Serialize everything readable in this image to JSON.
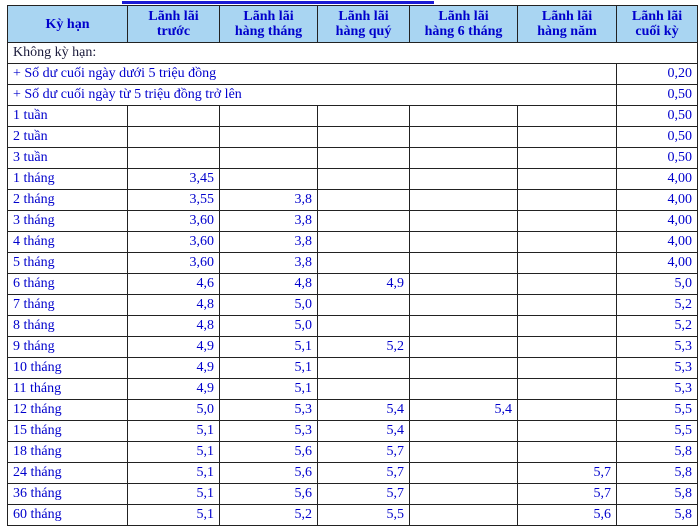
{
  "columns": [
    "Kỳ hạn",
    "Lãnh lãi trước",
    "Lãnh lãi hàng tháng",
    "Lãnh lãi hàng quý",
    "Lãnh lãi hàng 6 tháng",
    "Lãnh lãi hàng năm",
    "Lãnh lãi cuối kỳ"
  ],
  "header_lines": [
    [
      "Kỳ hạn",
      ""
    ],
    [
      "Lãnh lãi",
      "trước"
    ],
    [
      "Lãnh lãi",
      "hàng tháng"
    ],
    [
      "Lãnh lãi",
      "hàng quý"
    ],
    [
      "Lãnh lãi",
      "hàng 6 tháng"
    ],
    [
      "Lãnh lãi",
      "hàng năm"
    ],
    [
      "Lãnh lãi",
      "cuối kỳ"
    ]
  ],
  "group_label": "Không kỳ hạn:",
  "demand_rows": [
    {
      "label": "+ Số dư cuối ngày dưới 5 triệu đồng",
      "rate": "0,20"
    },
    {
      "label": "+ Số dư cuối ngày từ 5 triệu đồng trở lên",
      "rate": "0,50"
    }
  ],
  "rows": [
    {
      "term": "1 tuần",
      "values": [
        "",
        "",
        "",
        "",
        "",
        "0,50"
      ]
    },
    {
      "term": "2 tuần",
      "values": [
        "",
        "",
        "",
        "",
        "",
        "0,50"
      ]
    },
    {
      "term": "3 tuần",
      "values": [
        "",
        "",
        "",
        "",
        "",
        "0,50"
      ]
    },
    {
      "term": "1 tháng",
      "values": [
        "3,45",
        "",
        "",
        "",
        "",
        "4,00"
      ]
    },
    {
      "term": "2 tháng",
      "values": [
        "3,55",
        "3,8",
        "",
        "",
        "",
        "4,00"
      ]
    },
    {
      "term": "3 tháng",
      "values": [
        "3,60",
        "3,8",
        "",
        "",
        "",
        "4,00"
      ]
    },
    {
      "term": "4 tháng",
      "values": [
        "3,60",
        "3,8",
        "",
        "",
        "",
        "4,00"
      ]
    },
    {
      "term": "5 tháng",
      "values": [
        "3,60",
        "3,8",
        "",
        "",
        "",
        "4,00"
      ]
    },
    {
      "term": "6 tháng",
      "values": [
        "4,6",
        "4,8",
        "4,9",
        "",
        "",
        "5,0"
      ]
    },
    {
      "term": "7 tháng",
      "values": [
        "4,8",
        "5,0",
        "",
        "",
        "",
        "5,2"
      ]
    },
    {
      "term": "8 tháng",
      "values": [
        "4,8",
        "5,0",
        "",
        "",
        "",
        "5,2"
      ]
    },
    {
      "term": "9 tháng",
      "values": [
        "4,9",
        "5,1",
        "5,2",
        "",
        "",
        "5,3"
      ]
    },
    {
      "term": "10 tháng",
      "values": [
        "4,9",
        "5,1",
        "",
        "",
        "",
        "5,3"
      ]
    },
    {
      "term": "11 tháng",
      "values": [
        "4,9",
        "5,1",
        "",
        "",
        "",
        "5,3"
      ]
    },
    {
      "term": "12 tháng",
      "values": [
        "5,0",
        "5,3",
        "5,4",
        "5,4",
        "",
        "5,5"
      ]
    },
    {
      "term": "15 tháng",
      "values": [
        "5,1",
        "5,3",
        "5,4",
        "",
        "",
        "5,5"
      ]
    },
    {
      "term": "18 tháng",
      "values": [
        "5,1",
        "5,6",
        "5,7",
        "",
        "",
        "5,8"
      ]
    },
    {
      "term": "24 tháng",
      "values": [
        "5,1",
        "5,6",
        "5,7",
        "",
        "5,7",
        "5,8"
      ]
    },
    {
      "term": "36 tháng",
      "values": [
        "5,1",
        "5,6",
        "5,7",
        "",
        "5,7",
        "5,8"
      ]
    },
    {
      "term": "60 tháng",
      "values": [
        "5,1",
        "5,2",
        "5,5",
        "",
        "5,6",
        "5,8"
      ]
    }
  ],
  "colors": {
    "header_bg": "#a9d5f2",
    "text": "#0000cc",
    "accent_line": "#1a1ad4",
    "border": "#222222"
  }
}
